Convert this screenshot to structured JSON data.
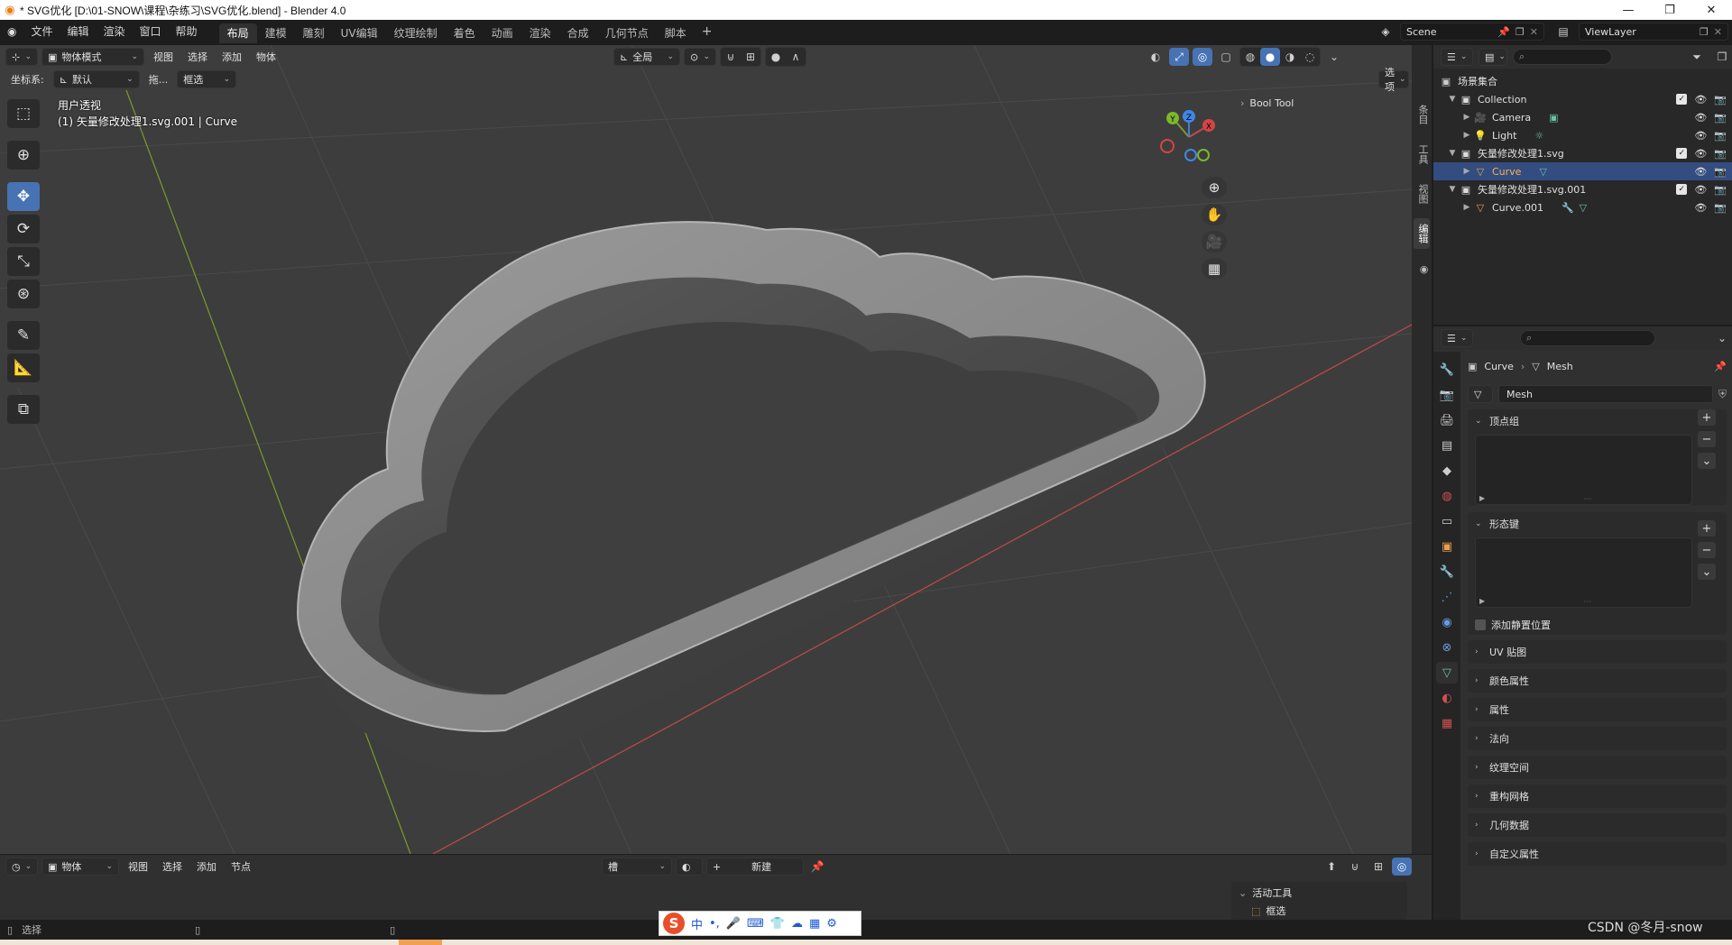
{
  "window": {
    "title": "* SVG优化 [D:\\01-SNOW\\课程\\杂练习\\SVG优化.blend] - Blender 4.0",
    "controls": [
      "minimize",
      "restore",
      "close"
    ]
  },
  "topbar": {
    "menus": [
      "文件",
      "编辑",
      "渲染",
      "窗口",
      "帮助"
    ],
    "workspaces": [
      "布局",
      "建模",
      "雕刻",
      "UV编辑",
      "纹理绘制",
      "着色",
      "动画",
      "渲染",
      "合成",
      "几何节点",
      "脚本"
    ],
    "active_workspace": "布局",
    "add_workspace": "+",
    "scene": "Scene",
    "view_layer": "ViewLayer"
  },
  "viewport": {
    "mode": "物体模式",
    "menus": [
      "视图",
      "选择",
      "添加",
      "物体"
    ],
    "transform_orientation": "全局",
    "coord_label": "坐标系:",
    "coord_value": "默认",
    "drag_label": "拖...",
    "drag_value": "框选",
    "options_label": "选项",
    "view_name": "用户透视",
    "object_info": "(1) 矢量修改处理1.svg.001 | Curve",
    "npanel_header": "Bool Tool",
    "npanel_tabs": [
      "条目",
      "工具",
      "视图",
      "编辑"
    ],
    "gizmo_axes": [
      "X",
      "Y",
      "Z"
    ],
    "colors": {
      "x_axis": "#c24a4a",
      "y_axis": "#7a9c2c",
      "z_axis": "#3f7fd6",
      "background": "#3d3d3d",
      "accent": "#4772b3"
    }
  },
  "timeline": {
    "editor": "物体",
    "menus": [
      "视图",
      "选择",
      "添加",
      "节点"
    ],
    "slot_label": "槽",
    "new_label": "新建",
    "active_tool_title": "活动工具",
    "active_tool_item": "框选"
  },
  "statusbar": {
    "select_label": "选择"
  },
  "ime": {
    "logo": "S",
    "items": [
      "中",
      "•,",
      "🎤",
      "⌨",
      "👕",
      "☁",
      "▦",
      "⚙"
    ]
  },
  "watermark": "CSDN @冬月-snow",
  "outliner": {
    "root": "场景集合",
    "items": [
      {
        "label": "Collection",
        "depth": 1,
        "type": "collection",
        "expanded": true,
        "checked": true
      },
      {
        "label": "Camera",
        "depth": 2,
        "type": "camera"
      },
      {
        "label": "Light",
        "depth": 2,
        "type": "light"
      },
      {
        "label": "矢量修改处理1.svg",
        "depth": 1,
        "type": "collection",
        "expanded": true,
        "checked": true
      },
      {
        "label": "Curve",
        "depth": 2,
        "type": "curve",
        "selected": true
      },
      {
        "label": "矢量修改处理1.svg.001",
        "depth": 1,
        "type": "collection",
        "expanded": true,
        "checked": true
      },
      {
        "label": "Curve.001",
        "depth": 2,
        "type": "curve"
      }
    ]
  },
  "properties": {
    "breadcrumb_object": "Curve",
    "breadcrumb_data": "Mesh",
    "mesh_name": "Mesh",
    "panels_open": [
      "顶点组",
      "形态键"
    ],
    "shape_key_option": "添加静置位置",
    "panels_closed": [
      "UV 贴图",
      "颜色属性",
      "属性",
      "法向",
      "纹理空间",
      "重构网格",
      "几何数据",
      "自定义属性"
    ]
  }
}
